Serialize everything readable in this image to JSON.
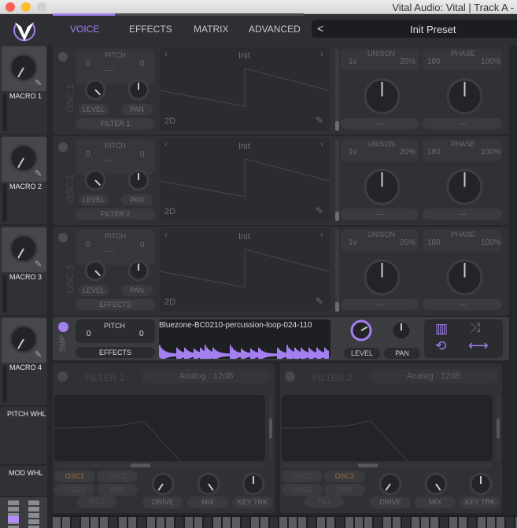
{
  "window": {
    "title": "Vital Audio: Vital  | Track A -"
  },
  "tabs": [
    "VOICE",
    "EFFECTS",
    "MATRIX",
    "ADVANCED"
  ],
  "active_tab": "VOICE",
  "preset": {
    "name": "Init Preset",
    "prev": "<"
  },
  "macros": [
    {
      "label": "MACRO 1"
    },
    {
      "label": "MACRO 2"
    },
    {
      "label": "MACRO 3"
    },
    {
      "label": "MACRO 4"
    }
  ],
  "wheels": {
    "pitch": "PITCH WHL",
    "mod": "MOD WHL"
  },
  "oscillators": [
    {
      "label": "OSC 1",
      "pitch_label": "PITCH",
      "pitch_left": "0",
      "pitch_right": "0",
      "level": "LEVEL",
      "pan": "PAN",
      "route": "FILTER 1",
      "wavetable": "Init",
      "dim": "2D",
      "unison": "UNISON",
      "unison_voices": "1v",
      "unison_detune": "20%",
      "phase": "PHASE",
      "phase_value": "180",
      "phase_rand": "100%",
      "mod_left": "---",
      "mod_right": "---"
    },
    {
      "label": "OSC 2",
      "pitch_label": "PITCH",
      "pitch_left": "0",
      "pitch_right": "0",
      "level": "LEVEL",
      "pan": "PAN",
      "route": "FILTER 2",
      "wavetable": "Init",
      "dim": "2D",
      "unison": "UNISON",
      "unison_voices": "1v",
      "unison_detune": "20%",
      "phase": "PHASE",
      "phase_value": "180",
      "phase_rand": "100%",
      "mod_left": "---",
      "mod_right": "---"
    },
    {
      "label": "OSC 3",
      "pitch_label": "PITCH",
      "pitch_left": "0",
      "pitch_right": "0",
      "level": "LEVEL",
      "pan": "PAN",
      "route": "EFFECTS",
      "wavetable": "Init",
      "dim": "2D",
      "unison": "UNISON",
      "unison_voices": "1v",
      "unison_detune": "20%",
      "phase": "PHASE",
      "phase_value": "180",
      "phase_rand": "100%",
      "mod_left": "---",
      "mod_right": "---"
    }
  ],
  "sampler": {
    "label": "SMP",
    "pitch_label": "PITCH",
    "pitch_left": "0",
    "pitch_right": "0",
    "route": "EFFECTS",
    "sample": "Bluezone-BC0210-percussion-loop-024-110",
    "level": "LEVEL",
    "pan": "PAN",
    "icons": [
      "keyboard-track-icon",
      "random-start-icon",
      "loop-icon",
      "bounce-icon"
    ]
  },
  "filters": [
    {
      "label": "FILTER 1",
      "model": "Analog : 12dB",
      "sources": [
        "OSC1",
        "OSC2",
        "OSC3",
        "SMP"
      ],
      "active_source": "OSC1",
      "fil": "FIL2",
      "drive": "DRIVE",
      "mix": "MIX",
      "keytrk": "KEY TRK"
    },
    {
      "label": "FILTER 2",
      "model": "Analog : 12dB",
      "sources": [
        "OSC1",
        "OSC2",
        "OSC3",
        "SMP"
      ],
      "active_source": "OSC2",
      "fil": "FIL1",
      "drive": "DRIVE",
      "mix": "MIX",
      "keytrk": "KEY TRK"
    }
  ],
  "colors": {
    "accent": "#a37ff0",
    "bg": "#25272a",
    "panel": "#2f3135",
    "source_active": "#a0703a"
  }
}
